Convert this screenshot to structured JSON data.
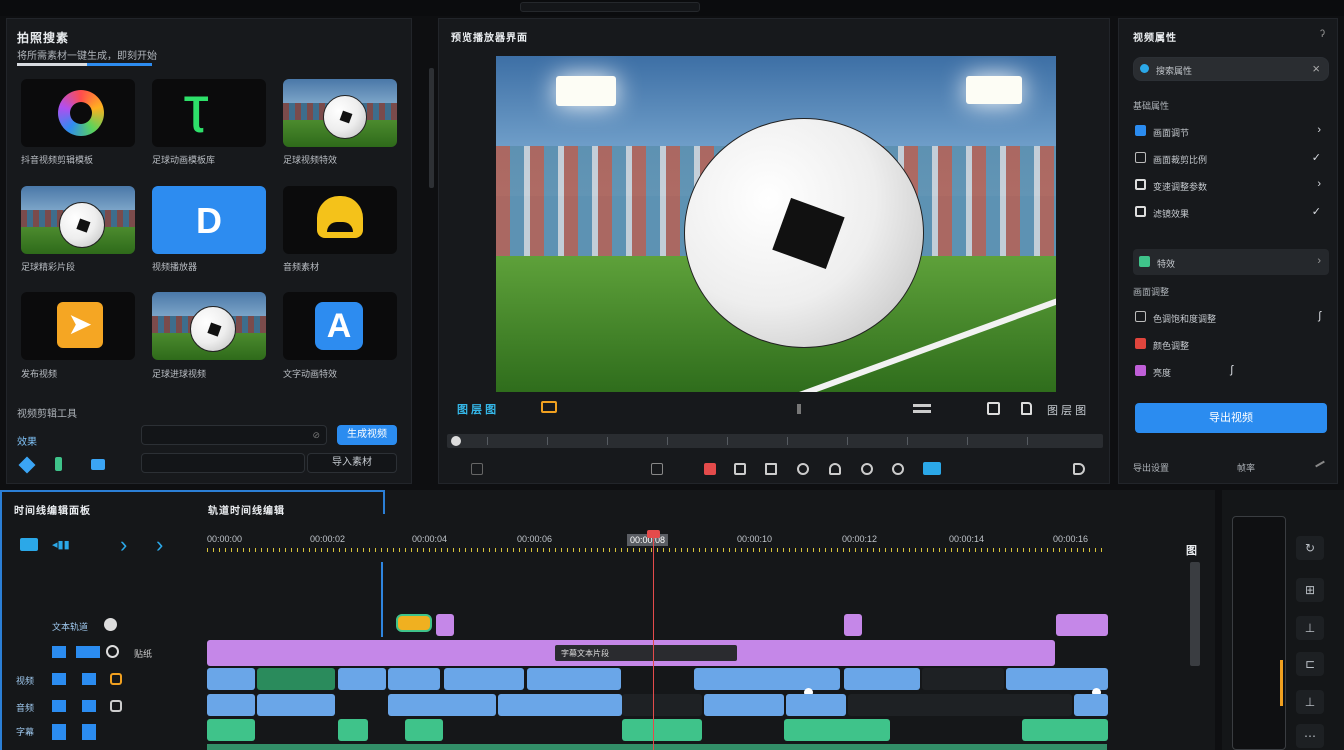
{
  "colors": {
    "accent": "#2b8cf0",
    "playhead": "#e44b4b",
    "clip_purple": "#c587e8",
    "clip_blue": "#6aa6e8",
    "clip_green": "#3fc38a"
  },
  "left": {
    "title": "拍照搜素",
    "subtitle": "将所需素材一键生成，即刻开始",
    "tiles": [
      {
        "caption": "抖音视频剪辑模板",
        "icon": "color-ring-icon"
      },
      {
        "caption": "足球动画模板库",
        "icon": "green-logo-icon"
      },
      {
        "caption": "足球视频特效",
        "icon": "soccer-thumb"
      },
      {
        "caption": "足球精彩片段",
        "icon": "soccer-thumb"
      },
      {
        "caption": "视频播放器",
        "icon": "play-d-icon"
      },
      {
        "caption": "音频素材",
        "icon": "face-icon"
      },
      {
        "caption": "发布视频",
        "icon": "arrow-icon"
      },
      {
        "caption": "足球进球视频",
        "icon": "soccer-thumb"
      },
      {
        "caption": "文字动画特效",
        "icon": "letter-a-icon"
      }
    ],
    "section_label": "视频剪辑工具",
    "group_label": "效果",
    "input1_value": "",
    "apply_button": "生成视频",
    "second_button": "导入素材"
  },
  "preview": {
    "title": "预览播放器界面",
    "controls_left": "图 层 图",
    "controls_right": "图 层 图",
    "bottom_icons": [
      "crop-icon",
      "mask-icon",
      "folder-icon",
      "wand-icon",
      "person-icon",
      "brush-icon",
      "chat-icon",
      "screen-icon",
      "play-icon"
    ]
  },
  "right": {
    "title": "视频属性",
    "search_placeholder": "搜索属性",
    "section1": "基础属性",
    "rows1": [
      {
        "label": "画面调节",
        "mark": "›"
      },
      {
        "label": "画面裁剪比例",
        "mark": "✓"
      },
      {
        "label": "变速调整参数",
        "mark": "›"
      },
      {
        "label": "滤镜效果",
        "mark": "✓"
      }
    ],
    "extra_row": "特效",
    "section2": "画面调整",
    "rows2": [
      {
        "label": "色调饱和度调整",
        "mark": "ʃ"
      },
      {
        "label": "颜色调整",
        "mark": ""
      },
      {
        "label": "亮度",
        "mark": "ʃ"
      }
    ],
    "export_button": "导出视频",
    "footer_left": "导出设置",
    "footer_mid": "帧率"
  },
  "timeline": {
    "tab_left": "时间线编辑面板",
    "tab_right": "轨道时间线编辑",
    "ruler": [
      "00:00:00",
      "00:00:02",
      "00:00:04",
      "00:00:06",
      "00:00:08",
      "00:00:10",
      "00:00:12",
      "00:00:14",
      "00:00:16"
    ],
    "track_labels": [
      "文本轨道",
      "贴纸",
      "视频",
      "音频",
      "字幕"
    ],
    "clip_text": "字幕文本片段",
    "right_label": "图"
  }
}
